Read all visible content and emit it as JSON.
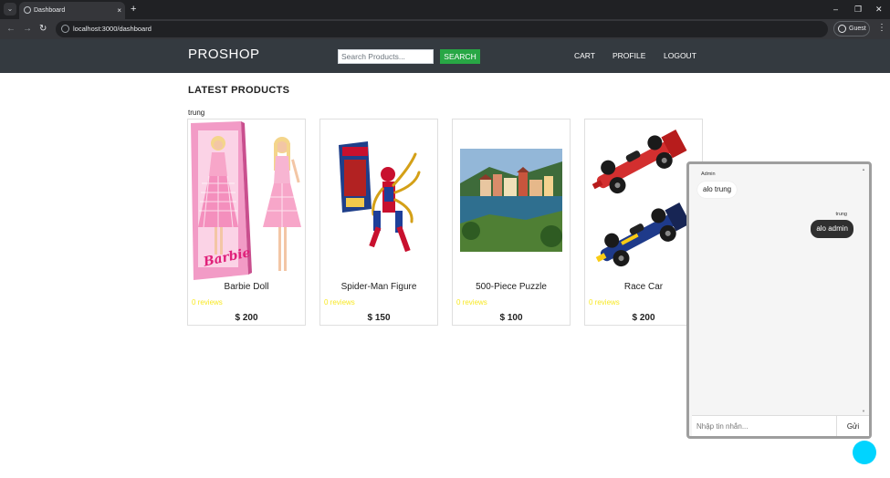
{
  "browser": {
    "tab_title": "Dashboard",
    "tab_close": "×",
    "new_tab": "+",
    "url": "localhost:3000/dashboard",
    "profile": "Guest",
    "back": "←",
    "forward": "→",
    "reload": "↻",
    "menu": "⋮",
    "tab_list": "⌄",
    "minimize": "–",
    "restore": "❐",
    "close": "✕"
  },
  "header": {
    "brand": "PROSHOP",
    "search_placeholder": "Search Products...",
    "search_button": "SEARCH",
    "nav": {
      "cart": "CART",
      "profile": "PROFILE",
      "logout": "LOGOUT"
    }
  },
  "main": {
    "heading": "LATEST PRODUCTS",
    "username": "trung",
    "products": [
      {
        "name": "Barbie Doll",
        "reviews": "0 reviews",
        "price": "$ 200"
      },
      {
        "name": "Spider-Man Figure",
        "reviews": "0 reviews",
        "price": "$ 150"
      },
      {
        "name": "500-Piece Puzzle",
        "reviews": "0 reviews",
        "price": "$ 100"
      },
      {
        "name": "Race Car",
        "reviews": "0 reviews",
        "price": "$ 200"
      }
    ],
    "barbie_logo_text": "Barbie"
  },
  "chat": {
    "messages": [
      {
        "sender": "Admin",
        "text": "alo trung"
      },
      {
        "sender": "trung",
        "text": "alo admin"
      }
    ],
    "input_placeholder": "Nhập tin nhắn...",
    "send_button": "Gửi"
  },
  "colors": {
    "header_bg": "#343a40",
    "search_button": "#28a745",
    "rating": "#f8e825",
    "chat_fab": "#00d4ff",
    "chat_bubble_self": "#2f2f2f"
  }
}
